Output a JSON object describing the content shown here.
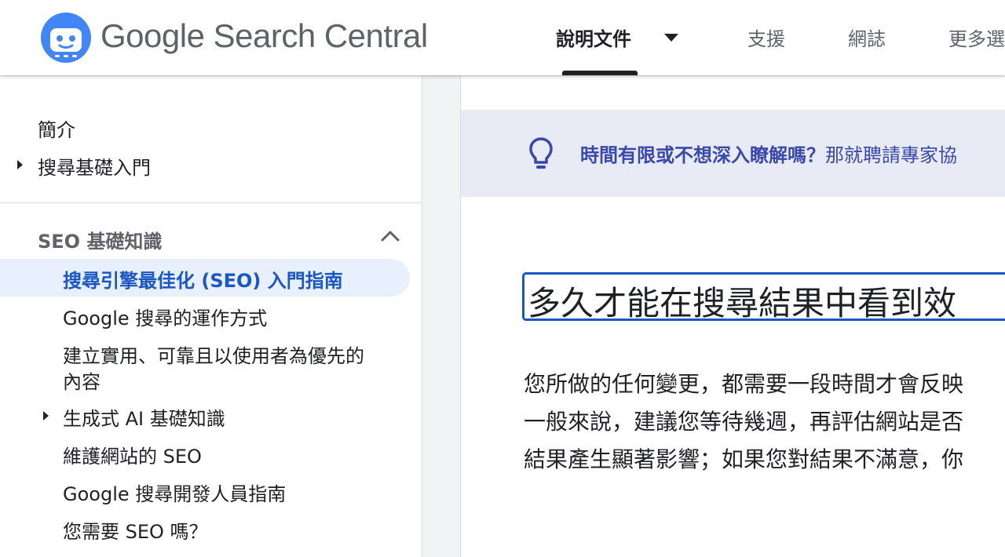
{
  "header": {
    "logo_text": "Google Search Central",
    "nav": [
      "說明文件",
      "支援",
      "網誌",
      "更多選"
    ]
  },
  "sidebar": {
    "top_items": [
      {
        "label": "簡介",
        "expandable": false
      },
      {
        "label": "搜尋基礎入門",
        "expandable": true
      }
    ],
    "section_title": "SEO 基礎知識",
    "section_items": [
      {
        "label": "搜尋引擎最佳化 (SEO) 入門指南",
        "active": true,
        "expandable": false
      },
      {
        "label": "Google 搜尋的運作方式",
        "active": false,
        "expandable": false
      },
      {
        "label": "建立實用、可靠且以使用者為優先的",
        "label_line2": "內容",
        "active": false,
        "expandable": false
      },
      {
        "label": "生成式 AI 基礎知識",
        "active": false,
        "expandable": true
      },
      {
        "label": "維護網站的 SEO",
        "active": false,
        "expandable": false
      },
      {
        "label": "Google 搜尋開發人員指南",
        "active": false,
        "expandable": false
      },
      {
        "label": "您需要 SEO 嗎？",
        "active": false,
        "expandable": false
      }
    ]
  },
  "main": {
    "callout": {
      "strong": "時間有限或不想深入瞭解嗎？",
      "rest": "那就聘請專家協"
    },
    "heading": "多久才能在搜尋結果中看到效",
    "paragraph_lines": [
      "您所做的任何變更，都需要一段時間才會反映",
      "一般來說，建議您等待幾週，再評估網站是否",
      "結果產生顯著影響；如果您對結果不滿意，你"
    ]
  },
  "colors": {
    "accent_blue": "#1a56c4",
    "callout_bg": "#e8eaf6",
    "active_bg": "#e8f0fe",
    "mascot_blue": "#4285f4"
  },
  "icons": [
    "google-developers-mascot-icon",
    "caret-down-icon",
    "chevron-up-icon",
    "expand-arrow-icon",
    "lightbulb-icon"
  ]
}
